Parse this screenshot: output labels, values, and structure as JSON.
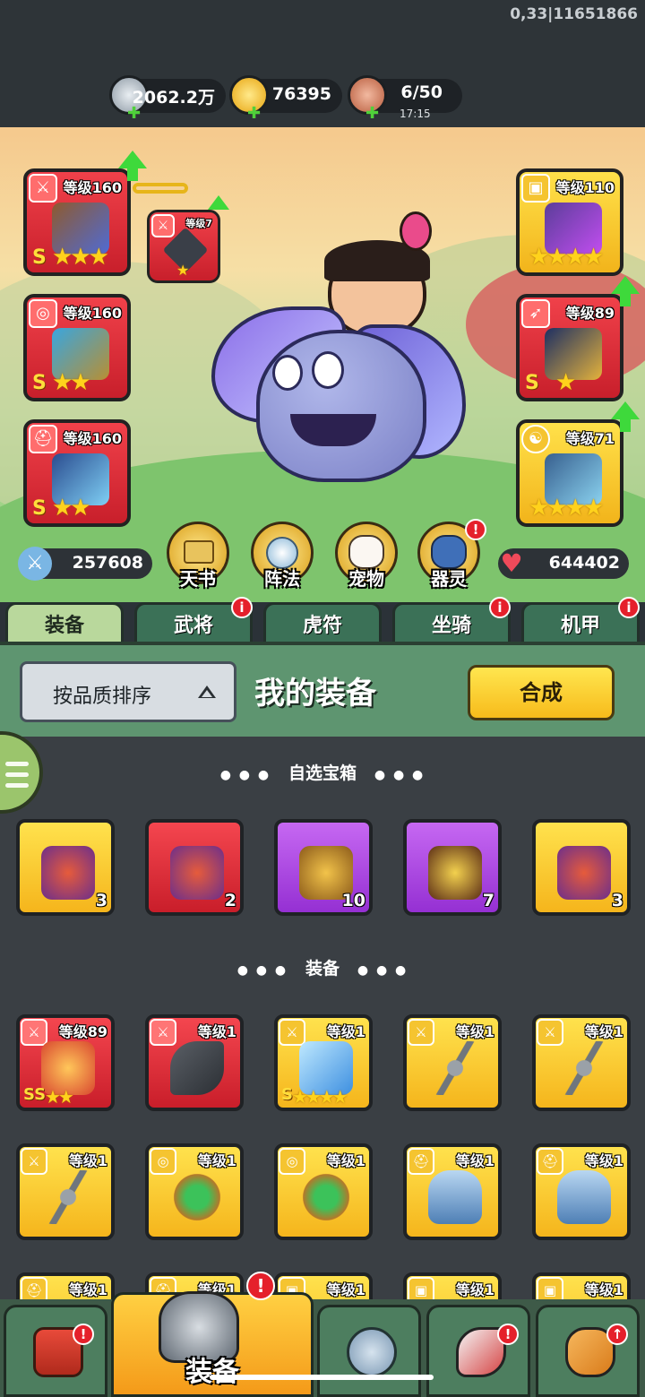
{
  "debug": "0,33|11651866",
  "resources": [
    {
      "name": "silver",
      "value": "2062.2万",
      "icon": "silver-coin-icon"
    },
    {
      "name": "gold",
      "value": "76395",
      "icon": "gold-ingot-icon"
    },
    {
      "name": "stamina",
      "value": "6/50",
      "sub": "17:15",
      "icon": "meat-icon"
    }
  ],
  "left_slots": [
    {
      "level": "等级160",
      "rank": "S",
      "stars": "★★★",
      "icon": "sword-icon",
      "color": "red"
    },
    {
      "level": "等级160",
      "rank": "S",
      "stars": "★★",
      "icon": "medal-icon",
      "color": "red"
    },
    {
      "level": "等级160",
      "rank": "S",
      "stars": "★★",
      "icon": "helmet-icon",
      "color": "red"
    }
  ],
  "small_slot": {
    "level": "等级7",
    "stars": "★"
  },
  "right_slots": [
    {
      "level": "等级110",
      "stars": "★★★★",
      "icon": "armor-icon",
      "color": "gold"
    },
    {
      "level": "等级89",
      "rank": "S",
      "stars": "★",
      "icon": "boot-icon",
      "color": "red"
    },
    {
      "level": "等级71",
      "stars": "★★★★",
      "icon": "yinyang-icon",
      "color": "gold"
    }
  ],
  "stats": {
    "attack": "257608",
    "hp": "644402"
  },
  "features": [
    {
      "label": "天书"
    },
    {
      "label": "阵法"
    },
    {
      "label": "宠物"
    },
    {
      "label": "器灵",
      "badge": "!"
    }
  ],
  "tabs": [
    {
      "label": "装备",
      "active": true
    },
    {
      "label": "武将",
      "badge": "i"
    },
    {
      "label": "虎符"
    },
    {
      "label": "坐骑",
      "badge": "i"
    },
    {
      "label": "机甲",
      "badge": "i"
    }
  ],
  "sort_label": "按品质排序",
  "my_equipment": "我的装备",
  "merge_label": "合成",
  "section_chests": "自选宝箱",
  "section_gear": "装备",
  "chests": [
    {
      "count": "3",
      "color": "gold"
    },
    {
      "count": "2",
      "color": "red"
    },
    {
      "count": "10",
      "color": "purple"
    },
    {
      "count": "7",
      "color": "purple"
    },
    {
      "count": "3",
      "color": "gold"
    }
  ],
  "gear_row1": [
    {
      "level": "等级89",
      "color": "red",
      "rank": "SS",
      "stars": "★★"
    },
    {
      "level": "等级1",
      "color": "red"
    },
    {
      "level": "等级1",
      "color": "gold",
      "rank": "S",
      "stars": "★★★★"
    },
    {
      "level": "等级1",
      "color": "gold"
    },
    {
      "level": "等级1",
      "color": "gold"
    }
  ],
  "gear_row2": [
    {
      "level": "等级1",
      "color": "gold"
    },
    {
      "level": "等级1",
      "color": "gold"
    },
    {
      "level": "等级1",
      "color": "gold"
    },
    {
      "level": "等级1",
      "color": "gold"
    },
    {
      "level": "等级1",
      "color": "gold"
    }
  ],
  "gear_row3": [
    {
      "level": "等级1"
    },
    {
      "level": "等级1"
    },
    {
      "level": "等级1"
    },
    {
      "level": "等级1"
    },
    {
      "level": "等级1"
    }
  ],
  "bottom_nav": [
    {
      "label": "",
      "icon": "shop-icon",
      "badge": "!"
    },
    {
      "label": "装备",
      "icon": "helmet-icon",
      "active": true,
      "badge": "!"
    },
    {
      "label": "",
      "icon": "crossed-swords-icon"
    },
    {
      "label": "",
      "icon": "horn-icon",
      "badge": "!"
    },
    {
      "label": "",
      "icon": "fist-upgrade-icon",
      "badge": "↑"
    }
  ]
}
